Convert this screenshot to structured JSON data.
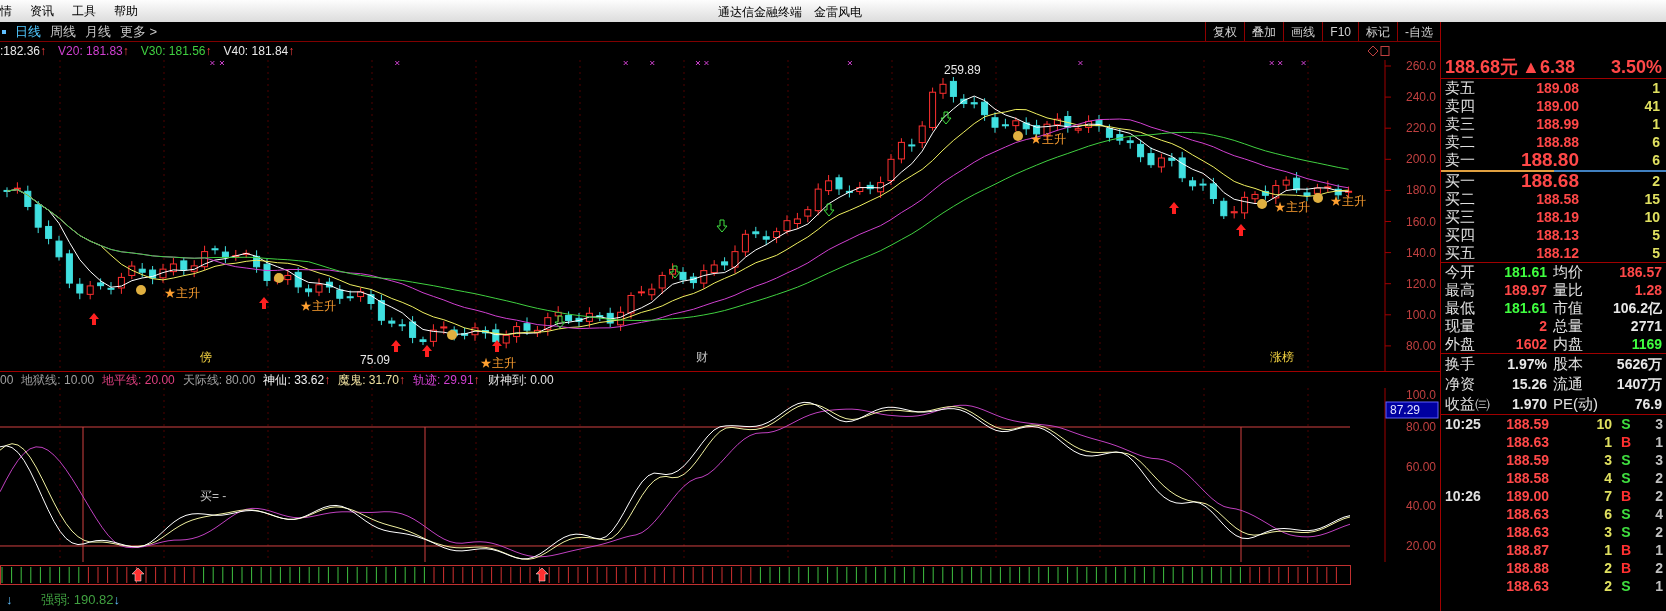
{
  "menu": [
    "情",
    "资讯",
    "工具",
    "帮助"
  ],
  "window": {
    "title": "通达信金融终端",
    "stock": "金雷风电"
  },
  "periods": [
    {
      "label": "日线",
      "selected": true
    },
    {
      "label": "周线",
      "selected": false
    },
    {
      "label": "月线",
      "selected": false
    },
    {
      "label": "更多 >",
      "selected": false
    }
  ],
  "tools": [
    "复权",
    "叠加",
    "画线",
    "F10",
    "标记",
    "-自选"
  ],
  "ma_legend": [
    {
      "text": ":182.36",
      "color": "#e8e8e8",
      "arrow": "↑"
    },
    {
      "text": "V20: 181.83",
      "color": "#d040d0",
      "arrow": "↑"
    },
    {
      "text": "V30: 181.56",
      "color": "#40d040",
      "arrow": "↑"
    },
    {
      "text": "V40: 181.84",
      "color": "#e8e8e8",
      "arrow": "↑"
    }
  ],
  "price_axis": [
    "260.0",
    "240.0",
    "220.0",
    "200.0",
    "180.0",
    "160.0",
    "140.0",
    "120.0",
    "100.0",
    "80.00"
  ],
  "annotations": [
    {
      "text": "259.89",
      "kind": "price"
    },
    {
      "text": "75.09",
      "kind": "price"
    },
    {
      "text": "★主升",
      "kind": "signal"
    },
    {
      "text": "★主升",
      "kind": "signal"
    },
    {
      "text": "★主升",
      "kind": "signal"
    },
    {
      "text": "★主升",
      "kind": "signal"
    },
    {
      "text": "★主升",
      "kind": "signal"
    },
    {
      "text": "★主升",
      "kind": "signal"
    },
    {
      "text": "傍",
      "kind": "tag"
    },
    {
      "text": "财",
      "kind": "note"
    },
    {
      "text": "涨榜",
      "kind": "tag"
    }
  ],
  "indicator_legend": [
    {
      "text": "00",
      "color": "#a0a0a0"
    },
    {
      "text": "地狱线: 10.00",
      "color": "#a0a0a0"
    },
    {
      "text": "地平线: 20.00",
      "color": "#e04080"
    },
    {
      "text": "天际线: 80.00",
      "color": "#a0a0a0"
    },
    {
      "text": "神仙: 33.62",
      "color": "#f0f0f0",
      "arrow": "↑"
    },
    {
      "text": "魔鬼: 31.70",
      "color": "#f0e0a0",
      "arrow": "↑"
    },
    {
      "text": "轨迹: 29.91",
      "color": "#d040d0",
      "arrow": "↑"
    },
    {
      "text": "财神到: 0.00",
      "color": "#e0e0e0"
    }
  ],
  "oscillator_axis": [
    "100.0",
    "80.00",
    "60.00",
    "40.00",
    "20.00"
  ],
  "oscillator_current": "87.29",
  "oscillator_note": "买= -",
  "status": {
    "arrow_left": "↓",
    "label": "强弱: 190.82",
    "arrow_right": "↓"
  },
  "quote": {
    "price": "188.68元",
    "change": "▲6.38",
    "percent": "3.50%"
  },
  "sell": [
    {
      "label": "卖五",
      "price": "189.08",
      "volume": "1",
      "best": false
    },
    {
      "label": "卖四",
      "price": "189.00",
      "volume": "41",
      "best": false
    },
    {
      "label": "卖三",
      "price": "188.99",
      "volume": "1",
      "best": false
    },
    {
      "label": "卖二",
      "price": "188.88",
      "volume": "6",
      "best": false
    },
    {
      "label": "卖一",
      "price": "188.80",
      "volume": "6",
      "best": true
    }
  ],
  "buy": [
    {
      "label": "买一",
      "price": "188.68",
      "volume": "2",
      "best": true
    },
    {
      "label": "买二",
      "price": "188.58",
      "volume": "15",
      "best": false
    },
    {
      "label": "买三",
      "price": "188.19",
      "volume": "10",
      "best": false
    },
    {
      "label": "买四",
      "price": "188.13",
      "volume": "5",
      "best": false
    },
    {
      "label": "买五",
      "price": "188.12",
      "volume": "5",
      "best": false
    }
  ],
  "stats": [
    [
      {
        "label": "今开",
        "value": "181.61",
        "kind": "down"
      },
      {
        "label": "均价",
        "value": "186.57",
        "kind": "up"
      }
    ],
    [
      {
        "label": "最高",
        "value": "189.97",
        "kind": "up"
      },
      {
        "label": "量比",
        "value": "1.28",
        "kind": "up"
      }
    ],
    [
      {
        "label": "最低",
        "value": "181.61",
        "kind": "down"
      },
      {
        "label": "市值",
        "value": "106.2亿",
        "kind": "flat"
      }
    ],
    [
      {
        "label": "现量",
        "value": "2",
        "kind": "up"
      },
      {
        "label": "总量",
        "value": "2771",
        "kind": "flat"
      }
    ],
    [
      {
        "label": "外盘",
        "value": "1602",
        "kind": "up"
      },
      {
        "label": "内盘",
        "value": "1169",
        "kind": "down"
      }
    ]
  ],
  "fundamentals": [
    [
      {
        "label": "换手",
        "value": "1.97%",
        "kind": "flat"
      },
      {
        "label": "股本",
        "value": "5626万",
        "kind": "flat"
      }
    ],
    [
      {
        "label": "净资",
        "value": "15.26",
        "kind": "flat"
      },
      {
        "label": "流通",
        "value": "1407万",
        "kind": "flat"
      }
    ],
    [
      {
        "label": "收益㈢",
        "value": "1.970",
        "kind": "flat"
      },
      {
        "label": "PE(动)",
        "value": "76.9",
        "kind": "flat"
      }
    ]
  ],
  "ticks": [
    {
      "time": "10:25",
      "price": "188.59",
      "volume": "10",
      "side": "S",
      "buy": false,
      "count": "3"
    },
    {
      "price": "188.63",
      "volume": "1",
      "side": "B",
      "buy": true,
      "count": "1"
    },
    {
      "price": "188.59",
      "volume": "3",
      "side": "S",
      "buy": false,
      "count": "3"
    },
    {
      "price": "188.58",
      "volume": "4",
      "side": "S",
      "buy": false,
      "count": "2"
    },
    {
      "time": "10:26",
      "price": "189.00",
      "volume": "7",
      "side": "B",
      "buy": true,
      "count": "2"
    },
    {
      "price": "188.63",
      "volume": "6",
      "side": "S",
      "buy": false,
      "count": "4"
    },
    {
      "price": "188.63",
      "volume": "3",
      "side": "S",
      "buy": false,
      "count": "2"
    },
    {
      "price": "188.87",
      "volume": "1",
      "side": "B",
      "buy": true,
      "count": "1"
    },
    {
      "price": "188.88",
      "volume": "2",
      "side": "B",
      "buy": true,
      "count": "2"
    },
    {
      "price": "188.63",
      "volume": "2",
      "side": "S",
      "buy": false,
      "count": "1"
    }
  ]
}
